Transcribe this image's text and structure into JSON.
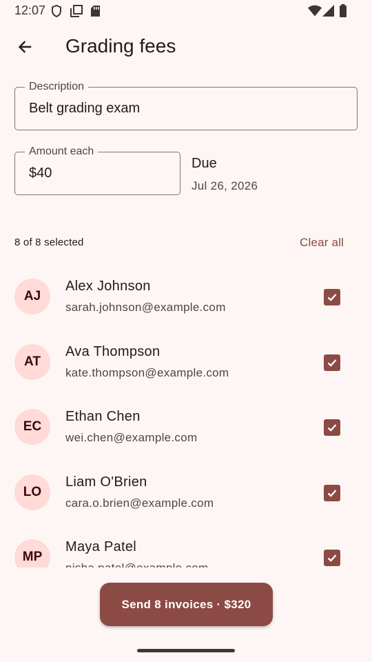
{
  "status_bar": {
    "time": "12:07",
    "icons": [
      "shield-icon",
      "screenshot-icon",
      "sd-card-icon",
      "wifi-icon",
      "signal-icon",
      "battery-icon"
    ]
  },
  "app_bar": {
    "back_icon": "arrow-left-icon",
    "title": "Grading fees"
  },
  "form": {
    "description": {
      "label": "Description",
      "value": "Belt grading exam"
    },
    "amount": {
      "label": "Amount each",
      "value": "$40"
    },
    "due": {
      "label": "Due",
      "value": "Jul 26, 2026"
    }
  },
  "selection": {
    "count_text": "8 of 8 selected",
    "clear_label": "Clear all"
  },
  "students": [
    {
      "initials": "AJ",
      "name": "Alex Johnson",
      "email": "sarah.johnson@example.com",
      "checked": true
    },
    {
      "initials": "AT",
      "name": "Ava Thompson",
      "email": "kate.thompson@example.com",
      "checked": true
    },
    {
      "initials": "EC",
      "name": "Ethan Chen",
      "email": "wei.chen@example.com",
      "checked": true
    },
    {
      "initials": "LO",
      "name": "Liam O'Brien",
      "email": "cara.o.brien@example.com",
      "checked": true
    },
    {
      "initials": "MP",
      "name": "Maya Patel",
      "email": "nisha.patel@example.com",
      "checked": true
    }
  ],
  "send_button": {
    "label": "Send 8 invoices · $320"
  },
  "colors": {
    "background": "#fdf6f5",
    "accent": "#8c4a44",
    "avatar_bg": "#ffdad6",
    "text_primary": "#231918",
    "text_secondary": "#534341"
  }
}
